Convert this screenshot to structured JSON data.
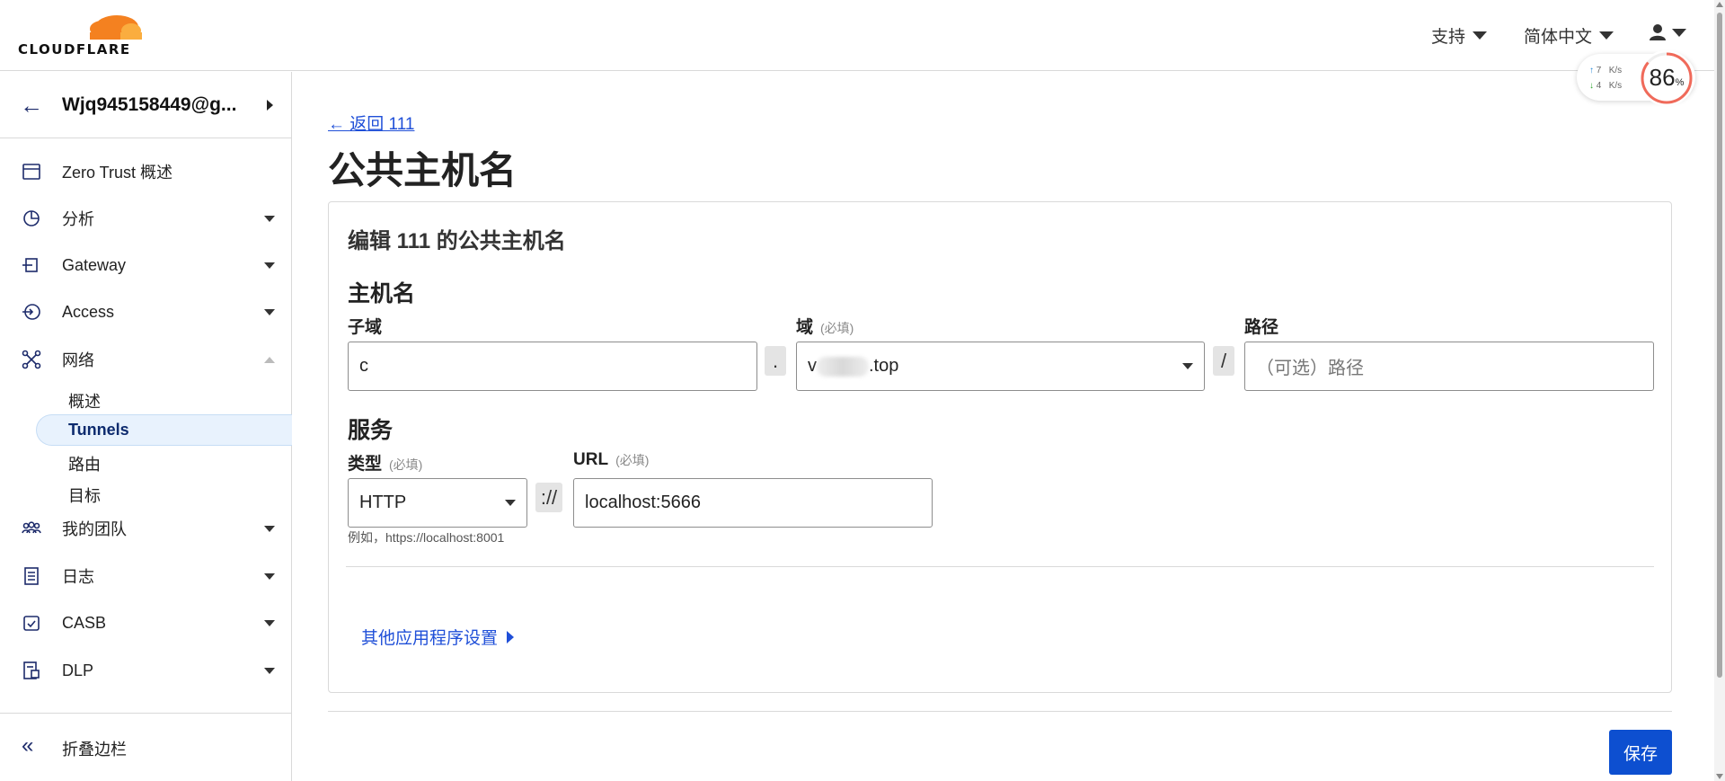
{
  "header": {
    "logo_text": "CLOUDFLARE",
    "support_label": "支持",
    "language_label": "简体中文"
  },
  "speed_widget": {
    "upload": "7",
    "download": "4",
    "unit": "K/s",
    "percent": "86",
    "percent_sign": "%"
  },
  "sidebar": {
    "account_name": "Wjq945158449@g...",
    "items": [
      {
        "label": "Zero Trust 概述",
        "icon": "browser-window-icon"
      },
      {
        "label": "分析",
        "icon": "pie-chart-icon"
      },
      {
        "label": "Gateway",
        "icon": "gateway-icon"
      },
      {
        "label": "Access",
        "icon": "access-icon"
      },
      {
        "label": "网络",
        "icon": "network-icon"
      },
      {
        "label": "我的团队",
        "icon": "team-icon"
      },
      {
        "label": "日志",
        "icon": "logs-icon"
      },
      {
        "label": "CASB",
        "icon": "casb-icon"
      },
      {
        "label": "DLP",
        "icon": "dlp-icon"
      }
    ],
    "network_sub": [
      "概述",
      "Tunnels",
      "路由",
      "目标"
    ],
    "collapse_label": "折叠边栏"
  },
  "main": {
    "back_link": "← 返回 111",
    "page_title": "公共主机名",
    "card_title": "编辑 111 的公共主机名",
    "hostname_section": "主机名",
    "subdomain_label": "子域",
    "subdomain_value": "c",
    "domain_label": "域",
    "required": "(必填)",
    "domain_value_prefix": "v",
    "domain_value_suffix": ".top",
    "path_label": "路径",
    "path_placeholder": "（可选）路径",
    "dot_sep": ".",
    "slash_sep": "/",
    "service_section": "服务",
    "type_label": "类型",
    "type_value": "HTTP",
    "scheme_sep": "://",
    "url_label": "URL",
    "url_value": "localhost:5666",
    "url_hint": "例如，https://localhost:8001",
    "more_settings": "其他应用程序设置",
    "save_label": "保存"
  }
}
